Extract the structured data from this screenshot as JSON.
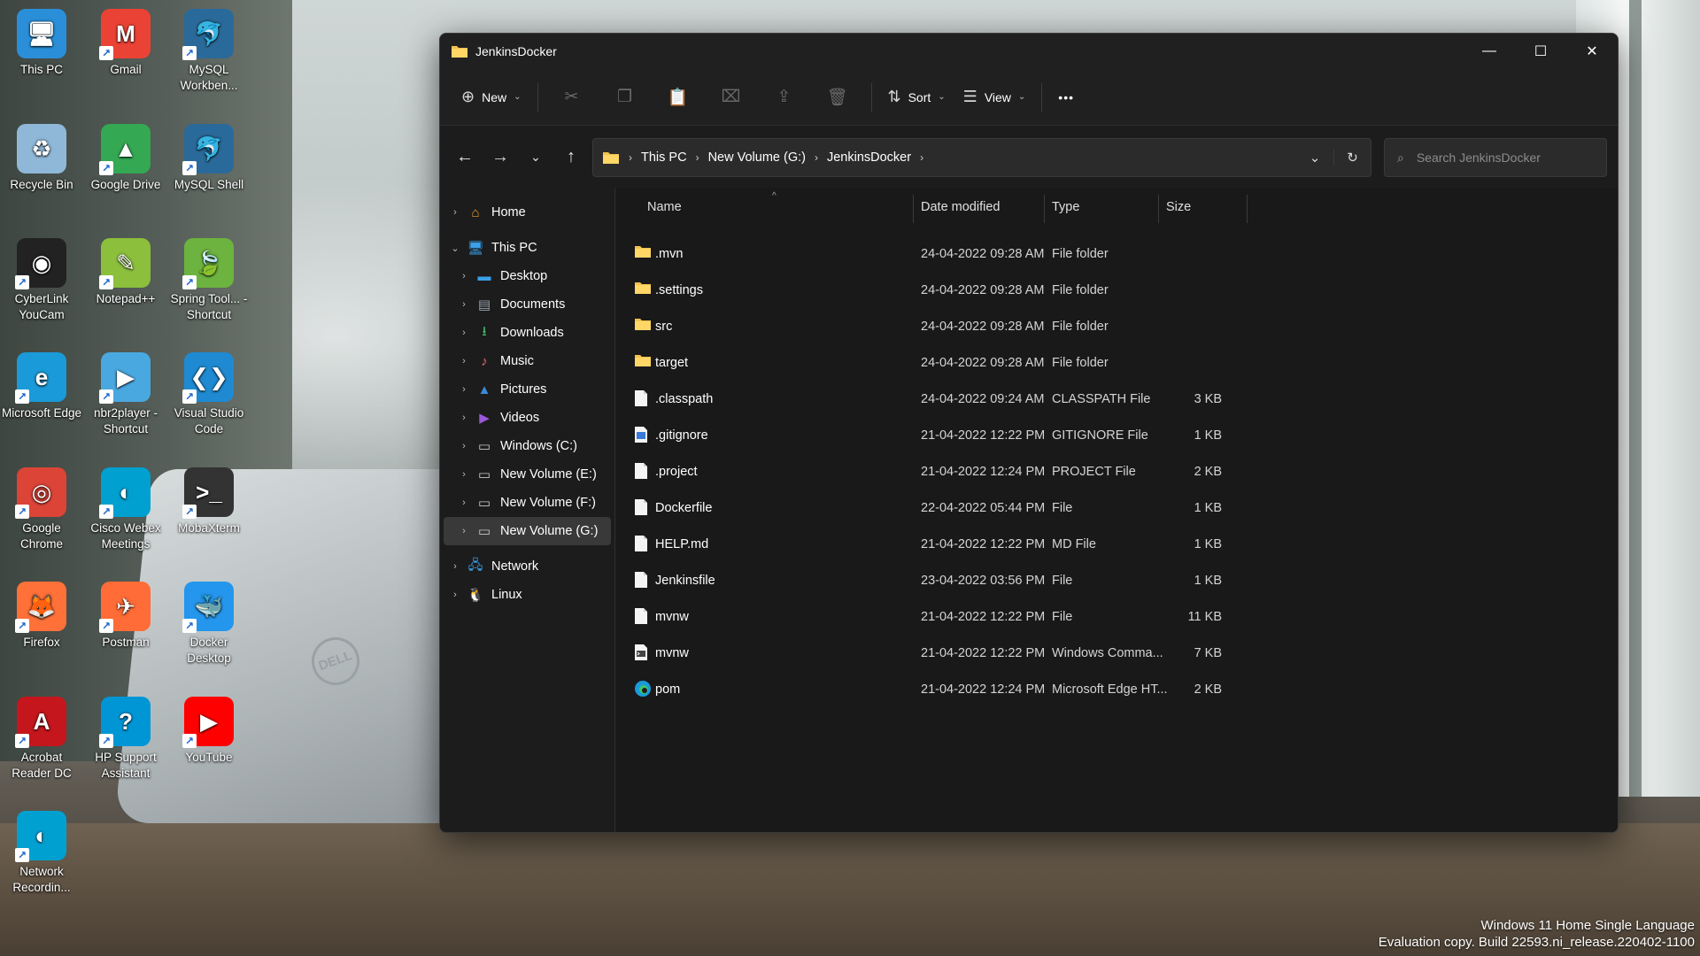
{
  "desktop": {
    "icons": [
      {
        "label": "This PC",
        "icon": "monitor-icon",
        "color": "#2a8fd8"
      },
      {
        "label": "Gmail",
        "icon": "gmail-icon",
        "color": "#ea4335"
      },
      {
        "label": "MySQL Workben...",
        "icon": "mysql-workbench-icon",
        "color": "#2a6a9a"
      },
      {
        "label": "Recycle Bin",
        "icon": "recycle-bin-icon",
        "color": "#8fb8d8"
      },
      {
        "label": "Google Drive",
        "icon": "google-drive-icon",
        "color": "#34a853"
      },
      {
        "label": "MySQL Shell",
        "icon": "mysql-shell-icon",
        "color": "#2a6a9a"
      },
      {
        "label": "CyberLink YouCam",
        "icon": "youcam-icon",
        "color": "#222222"
      },
      {
        "label": "Notepad++",
        "icon": "notepad-plus-plus-icon",
        "color": "#8bbf3c"
      },
      {
        "label": "Spring Tool... - Shortcut",
        "icon": "spring-tool-icon",
        "color": "#6db33f"
      },
      {
        "label": "Microsoft Edge",
        "icon": "edge-icon",
        "color": "#1a9ad8"
      },
      {
        "label": "nbr2player - Shortcut",
        "icon": "nbr2player-icon",
        "color": "#4aa8e0"
      },
      {
        "label": "Visual Studio Code",
        "icon": "vscode-icon",
        "color": "#1f8ad2"
      },
      {
        "label": "Google Chrome",
        "icon": "chrome-icon",
        "color": "#db4437"
      },
      {
        "label": "Cisco Webex Meetings",
        "icon": "webex-icon",
        "color": "#00a0d1"
      },
      {
        "label": "MobaXterm",
        "icon": "mobaxterm-icon",
        "color": "#333333"
      },
      {
        "label": "Firefox",
        "icon": "firefox-icon",
        "color": "#ff7139"
      },
      {
        "label": "Postman",
        "icon": "postman-icon",
        "color": "#ff6c37"
      },
      {
        "label": "Docker Desktop",
        "icon": "docker-icon",
        "color": "#2496ed"
      },
      {
        "label": "Acrobat Reader DC",
        "icon": "acrobat-icon",
        "color": "#c4161c"
      },
      {
        "label": "HP Support Assistant",
        "icon": "hp-support-icon",
        "color": "#0096d6"
      },
      {
        "label": "YouTube",
        "icon": "youtube-icon",
        "color": "#ff0000"
      },
      {
        "label": "Network Recordin...",
        "icon": "network-recording-icon",
        "color": "#00a0d1"
      }
    ]
  },
  "window": {
    "title": "JenkinsDocker",
    "minimize": "—",
    "maximize": "☐",
    "close": "✕"
  },
  "toolbar": {
    "new_label": "New",
    "sort_label": "Sort",
    "view_label": "View",
    "more": "•••"
  },
  "address": {
    "crumbs": [
      "This PC",
      "New Volume (G:)",
      "JenkinsDocker"
    ],
    "search_placeholder": "Search JenkinsDocker"
  },
  "nav": {
    "items": [
      {
        "label": "Home",
        "icon": "home-icon",
        "level": 0,
        "expander": "›"
      },
      {
        "label": "This PC",
        "icon": "this-pc-icon",
        "level": 0,
        "expander": "⌄"
      },
      {
        "label": "Desktop",
        "icon": "desktop-icon",
        "level": 1,
        "expander": "›"
      },
      {
        "label": "Documents",
        "icon": "documents-icon",
        "level": 1,
        "expander": "›"
      },
      {
        "label": "Downloads",
        "icon": "downloads-icon",
        "level": 1,
        "expander": "›"
      },
      {
        "label": "Music",
        "icon": "music-icon",
        "level": 1,
        "expander": "›"
      },
      {
        "label": "Pictures",
        "icon": "pictures-icon",
        "level": 1,
        "expander": "›"
      },
      {
        "label": "Videos",
        "icon": "videos-icon",
        "level": 1,
        "expander": "›"
      },
      {
        "label": "Windows (C:)",
        "icon": "drive-icon",
        "level": 1,
        "expander": "›"
      },
      {
        "label": "New Volume (E:)",
        "icon": "drive-icon",
        "level": 1,
        "expander": "›"
      },
      {
        "label": "New Volume (F:)",
        "icon": "drive-icon",
        "level": 1,
        "expander": "›"
      },
      {
        "label": "New Volume (G:)",
        "icon": "drive-icon",
        "level": 1,
        "expander": "›",
        "selected": true
      },
      {
        "label": "Network",
        "icon": "network-icon",
        "level": 0,
        "expander": "›"
      },
      {
        "label": "Linux",
        "icon": "linux-icon",
        "level": 0,
        "expander": "›"
      }
    ]
  },
  "columns": {
    "name": "Name",
    "date": "Date modified",
    "type": "Type",
    "size": "Size"
  },
  "files": [
    {
      "name": ".mvn",
      "date": "24-04-2022 09:28 AM",
      "type": "File folder",
      "size": "",
      "icon": "folder-icon"
    },
    {
      "name": ".settings",
      "date": "24-04-2022 09:28 AM",
      "type": "File folder",
      "size": "",
      "icon": "folder-icon"
    },
    {
      "name": "src",
      "date": "24-04-2022 09:28 AM",
      "type": "File folder",
      "size": "",
      "icon": "folder-icon"
    },
    {
      "name": "target",
      "date": "24-04-2022 09:28 AM",
      "type": "File folder",
      "size": "",
      "icon": "folder-icon"
    },
    {
      "name": ".classpath",
      "date": "24-04-2022 09:24 AM",
      "type": "CLASSPATH File",
      "size": "3 KB",
      "icon": "file-icon"
    },
    {
      "name": ".gitignore",
      "date": "21-04-2022 12:22 PM",
      "type": "GITIGNORE File",
      "size": "1 KB",
      "icon": "text-file-icon"
    },
    {
      "name": ".project",
      "date": "21-04-2022 12:24 PM",
      "type": "PROJECT File",
      "size": "2 KB",
      "icon": "file-icon"
    },
    {
      "name": "Dockerfile",
      "date": "22-04-2022 05:44 PM",
      "type": "File",
      "size": "1 KB",
      "icon": "file-icon"
    },
    {
      "name": "HELP.md",
      "date": "21-04-2022 12:22 PM",
      "type": "MD File",
      "size": "1 KB",
      "icon": "file-icon"
    },
    {
      "name": "Jenkinsfile",
      "date": "23-04-2022 03:56 PM",
      "type": "File",
      "size": "1 KB",
      "icon": "file-icon"
    },
    {
      "name": "mvnw",
      "date": "21-04-2022 12:22 PM",
      "type": "File",
      "size": "11 KB",
      "icon": "file-icon"
    },
    {
      "name": "mvnw",
      "date": "21-04-2022 12:22 PM",
      "type": "Windows Comma...",
      "size": "7 KB",
      "icon": "cmd-file-icon"
    },
    {
      "name": "pom",
      "date": "21-04-2022 12:24 PM",
      "type": "Microsoft Edge HT...",
      "size": "2 KB",
      "icon": "edge-html-icon"
    }
  ],
  "watermark": {
    "line1": "Windows 11 Home Single Language",
    "line2": "Evaluation copy. Build 22593.ni_release.220402-1100"
  },
  "colors": {
    "folder": "#f2c14e",
    "accent": "#4cc2ff"
  }
}
